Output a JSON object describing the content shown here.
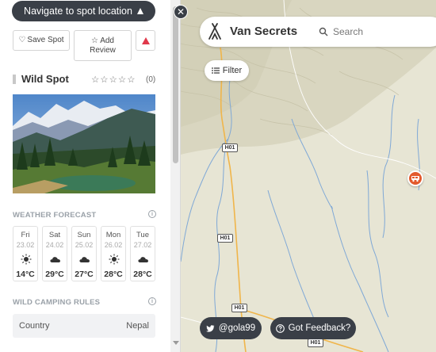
{
  "sidebar": {
    "navigate_label": "Navigate to spot location",
    "save_label": "Save Spot",
    "add_review_line1": "Add",
    "add_review_line2": "Review",
    "spot_title": "Wild Spot",
    "stars": "☆☆☆☆☆",
    "rating_count": "(0)",
    "weather_title": "WEATHER FORECAST",
    "forecast": [
      {
        "day": "Fri",
        "date": "23.02",
        "icon": "sun-icon",
        "temp": "14°C"
      },
      {
        "day": "Sat",
        "date": "24.02",
        "icon": "cloud-icon",
        "temp": "29°C"
      },
      {
        "day": "Sun",
        "date": "25.02",
        "icon": "cloud-icon",
        "temp": "27°C"
      },
      {
        "day": "Mon",
        "date": "26.02",
        "icon": "sun-icon",
        "temp": "28°C"
      },
      {
        "day": "Tue",
        "date": "27.02",
        "icon": "cloud-icon",
        "temp": "28°C"
      }
    ],
    "rules_title": "WILD CAMPING RULES",
    "rules": [
      {
        "key": "Country",
        "value": "Nepal"
      }
    ]
  },
  "header": {
    "brand": "Van Secrets",
    "search_placeholder": "Search"
  },
  "map": {
    "filter_label": "Filter",
    "road_label": "H01",
    "twitter_label": "@gola99",
    "feedback_label": "Got Feedback?"
  },
  "colors": {
    "dark_pill": "#3a3f47",
    "marker": "#e35a2d",
    "report": "#e0394b",
    "river": "#7fa8d6",
    "road": "#f0b54a"
  }
}
